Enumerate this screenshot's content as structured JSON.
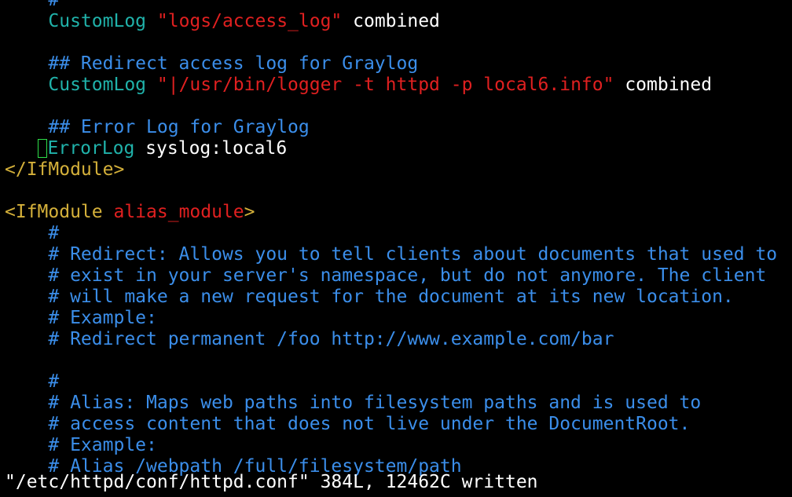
{
  "colors": {
    "background": "#000000",
    "comment": "#3b8eea",
    "keyword": "#20b2aa",
    "string": "#e02020",
    "tag": "#d4b03a",
    "normal": "#ffffff",
    "cursor": "#2ee04a"
  },
  "editor": {
    "lines": [
      {
        "indent": "    ",
        "tokens": [
          {
            "type": "comment",
            "text": "#"
          }
        ]
      },
      {
        "indent": "    ",
        "tokens": [
          {
            "type": "keyword",
            "text": "CustomLog"
          },
          {
            "type": "normal",
            "text": " "
          },
          {
            "type": "string",
            "text": "\"logs/access_log\""
          },
          {
            "type": "normal",
            "text": " combined"
          }
        ]
      },
      {
        "indent": "",
        "tokens": []
      },
      {
        "indent": "    ",
        "tokens": [
          {
            "type": "comment",
            "text": "## Redirect access log for Graylog"
          }
        ]
      },
      {
        "indent": "    ",
        "tokens": [
          {
            "type": "keyword",
            "text": "CustomLog"
          },
          {
            "type": "normal",
            "text": " "
          },
          {
            "type": "string",
            "text": "\"|/usr/bin/logger -t httpd -p local6.info\""
          },
          {
            "type": "normal",
            "text": " combined"
          }
        ]
      },
      {
        "indent": "",
        "tokens": []
      },
      {
        "indent": "    ",
        "tokens": [
          {
            "type": "comment",
            "text": "## Error Log for Graylog"
          }
        ]
      },
      {
        "indent": "   ",
        "cursor": true,
        "tokens": [
          {
            "type": "keyword",
            "text": "ErrorLog"
          },
          {
            "type": "normal",
            "text": " syslog:local6"
          }
        ]
      },
      {
        "indent": "",
        "tokens": [
          {
            "type": "tag",
            "text": "</IfModule>"
          }
        ]
      },
      {
        "indent": "",
        "tokens": []
      },
      {
        "indent": "",
        "tokens": [
          {
            "type": "tag",
            "text": "<IfModule "
          },
          {
            "type": "string",
            "text": "alias_module"
          },
          {
            "type": "tag",
            "text": ">"
          }
        ]
      },
      {
        "indent": "    ",
        "tokens": [
          {
            "type": "comment",
            "text": "#"
          }
        ]
      },
      {
        "indent": "    ",
        "tokens": [
          {
            "type": "comment",
            "text": "# Redirect: Allows you to tell clients about documents that used to"
          }
        ]
      },
      {
        "indent": "    ",
        "tokens": [
          {
            "type": "comment",
            "text": "# exist in your server's namespace, but do not anymore. The client"
          }
        ]
      },
      {
        "indent": "    ",
        "tokens": [
          {
            "type": "comment",
            "text": "# will make a new request for the document at its new location."
          }
        ]
      },
      {
        "indent": "    ",
        "tokens": [
          {
            "type": "comment",
            "text": "# Example:"
          }
        ]
      },
      {
        "indent": "    ",
        "tokens": [
          {
            "type": "comment",
            "text": "# Redirect permanent /foo http://www.example.com/bar"
          }
        ]
      },
      {
        "indent": "",
        "tokens": []
      },
      {
        "indent": "    ",
        "tokens": [
          {
            "type": "comment",
            "text": "#"
          }
        ]
      },
      {
        "indent": "    ",
        "tokens": [
          {
            "type": "comment",
            "text": "# Alias: Maps web paths into filesystem paths and is used to"
          }
        ]
      },
      {
        "indent": "    ",
        "tokens": [
          {
            "type": "comment",
            "text": "# access content that does not live under the DocumentRoot."
          }
        ]
      },
      {
        "indent": "    ",
        "tokens": [
          {
            "type": "comment",
            "text": "# Example:"
          }
        ]
      },
      {
        "indent": "    ",
        "tokens": [
          {
            "type": "comment",
            "text": "# Alias /webpath /full/filesystem/path"
          }
        ]
      }
    ],
    "status_line": "\"/etc/httpd/conf/httpd.conf\" 384L, 12462C written"
  }
}
